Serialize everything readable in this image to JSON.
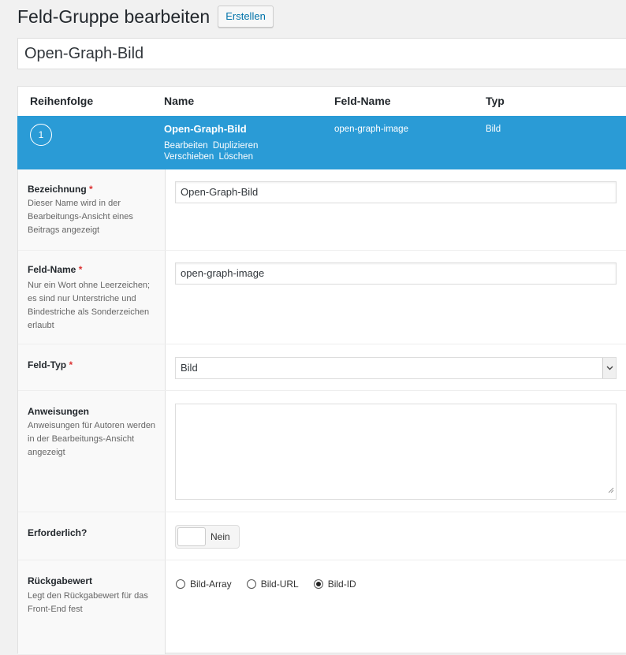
{
  "header": {
    "title": "Feld-Gruppe bearbeiten",
    "new_button": "Erstellen"
  },
  "group_title": "Open-Graph-Bild",
  "columns": {
    "order": "Reihenfolge",
    "label": "Name",
    "name": "Feld-Name",
    "type": "Typ"
  },
  "field": {
    "order": "1",
    "label": "Open-Graph-Bild",
    "name": "open-graph-image",
    "type": "Bild",
    "actions": {
      "edit": "Bearbeiten",
      "duplicate": "Duplizieren",
      "move": "Verschieben",
      "delete": "Löschen"
    },
    "row_color": "#2a9bd6"
  },
  "settings": {
    "label": {
      "title": "Bezeichnung",
      "required_mark": "*",
      "desc": "Dieser Name wird in der Bearbeitungs-Ansicht eines Beitrags angezeigt",
      "value": "Open-Graph-Bild"
    },
    "name": {
      "title": "Feld-Name",
      "required_mark": "*",
      "desc": "Nur ein Wort ohne Leerzeichen; es sind nur Unterstriche und Bindestriche als Sonderzeichen erlaubt",
      "value": "open-graph-image"
    },
    "type": {
      "title": "Feld-Typ",
      "required_mark": "*",
      "selected": "Bild"
    },
    "instructions": {
      "title": "Anweisungen",
      "desc": "Anweisungen für Autoren werden in der Bearbeitungs-Ansicht angezeigt",
      "value": ""
    },
    "required": {
      "title": "Erforderlich?",
      "toggle_text": "Nein",
      "toggle_on": false
    },
    "return_format": {
      "title": "Rückgabewert",
      "desc": "Legt den Rückgabewert für das Front-End fest",
      "options": [
        "Bild-Array",
        "Bild-URL",
        "Bild-ID"
      ],
      "selected": "Bild-ID"
    }
  }
}
